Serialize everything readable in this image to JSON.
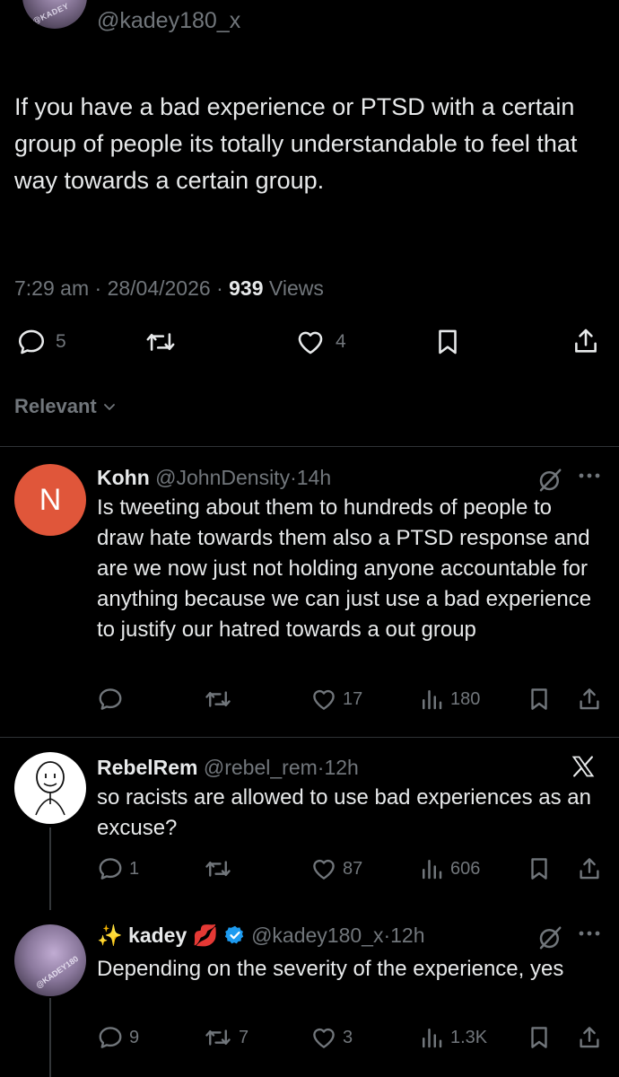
{
  "main_tweet": {
    "handle": "@kadey180_x",
    "avatar_watermark": "@KADEY",
    "text": "If you have a bad experience or PTSD with a certain group of people its totally understandable to feel that way towards a certain group.",
    "time": "7:29 am",
    "date": "28/04/2026",
    "views_count": "939",
    "views_label": "Views",
    "replies": "5",
    "likes": "4"
  },
  "sort": {
    "label": "Relevant"
  },
  "replies": [
    {
      "avatar_letter": "N",
      "avatar_color": "#e0563a",
      "name": "Kohn",
      "handle": "@JohnDensity",
      "time": "14h",
      "text": "Is tweeting about them to hundreds of people to draw hate towards them also a PTSD response and are we now just not holding anyone accountable for anything because we can just use a bad experience to justify our hatred towards a out group",
      "replies": "",
      "reposts": "",
      "likes": "17",
      "views": "180"
    },
    {
      "name": "RebelRem",
      "handle": "@rebel_rem",
      "time": "12h",
      "text": "so racists are allowed to use bad experiences as an excuse?",
      "replies": "1",
      "reposts": "",
      "likes": "87",
      "views": "606"
    },
    {
      "name_prefix": "✨",
      "name": "kadey",
      "name_suffix": "💋",
      "handle": "@kadey180_x",
      "time": "12h",
      "avatar_watermark": "@KADEY180",
      "text": "Depending on the severity of the experience, yes",
      "replies": "9",
      "reposts": "7",
      "likes": "3",
      "views": "1.3K"
    }
  ],
  "colors": {
    "background": "#000000",
    "text": "#e7e9ea",
    "muted": "#71767b",
    "divider": "#2f3336",
    "verified": "#1d9bf0"
  }
}
